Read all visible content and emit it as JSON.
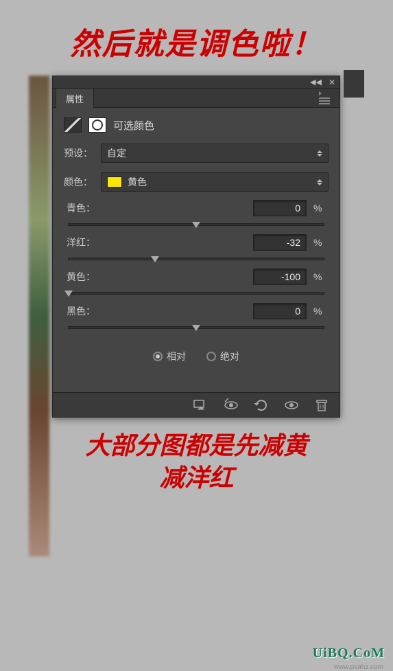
{
  "captions": {
    "top": "然后就是调色啦！",
    "bottom_line1": "大部分图都是先减黄",
    "bottom_line2": "减洋红"
  },
  "panel": {
    "tab": "属性",
    "adjustment_title": "可选颜色",
    "preset_label": "预设：",
    "preset_value": "自定",
    "color_label": "颜色：",
    "color_value": "黄色",
    "color_swatch": "#ffe600",
    "sliders": [
      {
        "label": "青色：",
        "value": "0",
        "pos": 50
      },
      {
        "label": "洋红：",
        "value": "-32",
        "pos": 34
      },
      {
        "label": "黄色：",
        "value": "-100",
        "pos": 0
      },
      {
        "label": "黑色：",
        "value": "0",
        "pos": 50
      }
    ],
    "pct": "%",
    "radios": {
      "relative": "相对",
      "absolute": "绝对",
      "selected": "relative"
    }
  },
  "watermark": {
    "main": "UiBQ.CoM",
    "sub": "www.psahz.com"
  }
}
